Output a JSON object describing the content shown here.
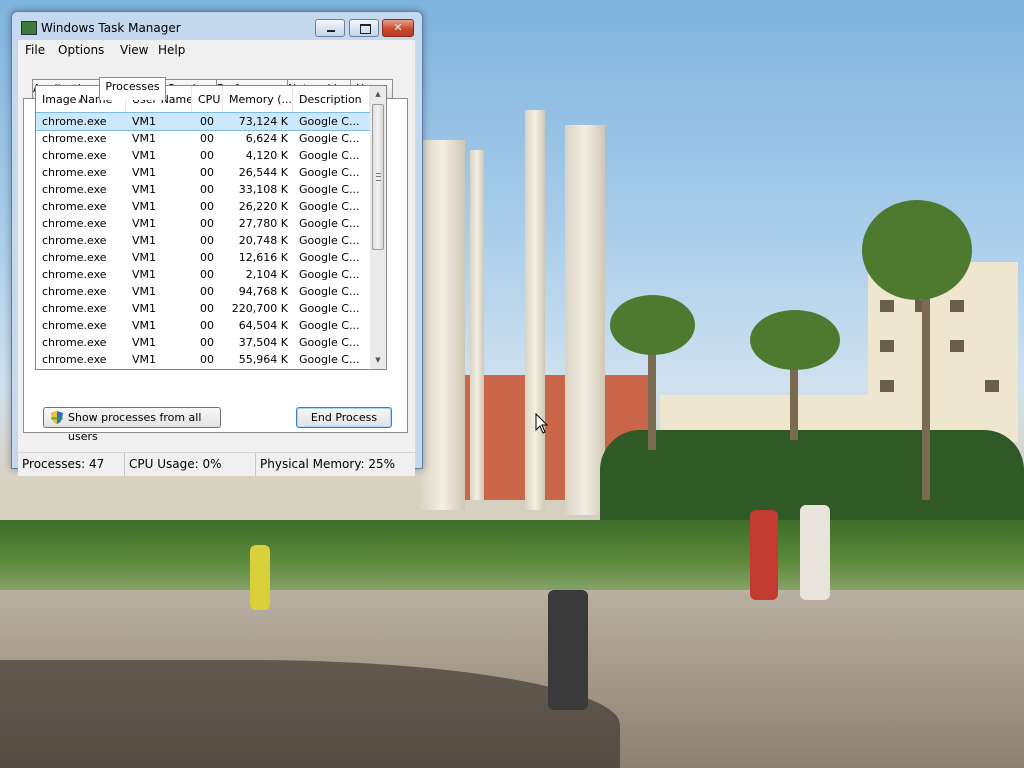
{
  "window": {
    "title": "Windows Task Manager",
    "controls": {
      "minimize": "",
      "maximize": "",
      "close": "✕"
    }
  },
  "menu": [
    "File",
    "Options",
    "View",
    "Help"
  ],
  "tabs": [
    "Applications",
    "Processes",
    "Services",
    "Performance",
    "Networking",
    "Users"
  ],
  "active_tab": "Processes",
  "process_table": {
    "columns": [
      "Image Name",
      "User Name",
      "CPU",
      "Memory (...",
      "Description"
    ],
    "sorted_column": "Image Name",
    "rows": [
      {
        "name": "chrome.exe",
        "user": "VM1",
        "cpu": "00",
        "memory": "73,124 K",
        "description": "Google C...",
        "selected": true
      },
      {
        "name": "chrome.exe",
        "user": "VM1",
        "cpu": "00",
        "memory": "6,624 K",
        "description": "Google C..."
      },
      {
        "name": "chrome.exe",
        "user": "VM1",
        "cpu": "00",
        "memory": "4,120 K",
        "description": "Google C..."
      },
      {
        "name": "chrome.exe",
        "user": "VM1",
        "cpu": "00",
        "memory": "26,544 K",
        "description": "Google C..."
      },
      {
        "name": "chrome.exe",
        "user": "VM1",
        "cpu": "00",
        "memory": "33,108 K",
        "description": "Google C..."
      },
      {
        "name": "chrome.exe",
        "user": "VM1",
        "cpu": "00",
        "memory": "26,220 K",
        "description": "Google C..."
      },
      {
        "name": "chrome.exe",
        "user": "VM1",
        "cpu": "00",
        "memory": "27,780 K",
        "description": "Google C..."
      },
      {
        "name": "chrome.exe",
        "user": "VM1",
        "cpu": "00",
        "memory": "20,748 K",
        "description": "Google C..."
      },
      {
        "name": "chrome.exe",
        "user": "VM1",
        "cpu": "00",
        "memory": "12,616 K",
        "description": "Google C..."
      },
      {
        "name": "chrome.exe",
        "user": "VM1",
        "cpu": "00",
        "memory": "2,104 K",
        "description": "Google C..."
      },
      {
        "name": "chrome.exe",
        "user": "VM1",
        "cpu": "00",
        "memory": "94,768 K",
        "description": "Google C..."
      },
      {
        "name": "chrome.exe",
        "user": "VM1",
        "cpu": "00",
        "memory": "220,700 K",
        "description": "Google C..."
      },
      {
        "name": "chrome.exe",
        "user": "VM1",
        "cpu": "00",
        "memory": "64,504 K",
        "description": "Google C..."
      },
      {
        "name": "chrome.exe",
        "user": "VM1",
        "cpu": "00",
        "memory": "37,504 K",
        "description": "Google C..."
      },
      {
        "name": "chrome.exe",
        "user": "VM1",
        "cpu": "00",
        "memory": "55,964 K",
        "description": "Google C..."
      }
    ]
  },
  "buttons": {
    "show_all_users": "Show processes from all users",
    "end_process": "End Process"
  },
  "status_bar": {
    "processes": "Processes: 47",
    "cpu_usage": "CPU Usage: 0%",
    "physical_memory": "Physical Memory: 25%"
  },
  "icons": {
    "app_icon": "task-manager-icon",
    "shield": "uac-shield-icon",
    "cursor": "mouse-pointer-icon"
  },
  "colors": {
    "selection": "#cce8ff",
    "title_bar": "#c4d8ee",
    "close_button": "#c84b30"
  }
}
